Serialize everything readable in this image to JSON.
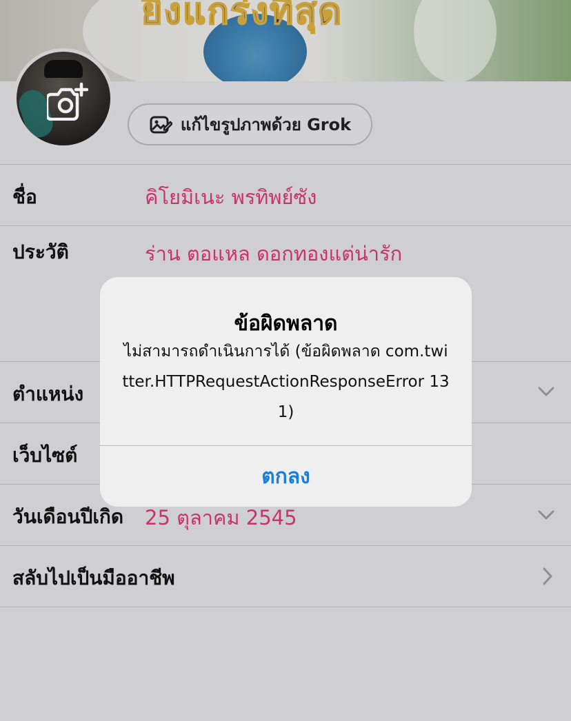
{
  "banner": {
    "text": "ยิ่งแกร่งที่สุด"
  },
  "grok_button": {
    "label": "แก้ไขรูปภาพด้วย Grok"
  },
  "rows": {
    "name": {
      "label": "ชื่อ",
      "value": "คิโยมิเนะ พรทิพย์ซัง"
    },
    "bio": {
      "label": "ประวัติ",
      "value": "ร่าน ตอแหล ดอกทองแต่น่ารัก"
    },
    "location": {
      "label": "ตำแหน่ง"
    },
    "website": {
      "label": "เว็บไซต์"
    },
    "birthday": {
      "label": "วันเดือนปีเกิด",
      "value": "25 ตุลาคม 2545"
    },
    "professional": {
      "label": "สลับไปเป็นมืออาชีพ"
    }
  },
  "alert": {
    "title": "ข้อผิดพลาด",
    "message": "ไม่สามารถดำเนินการได้ (ข้อผิดพลาด com.twitter.HTTPRequestActionResponseError 131)",
    "ok_label": "ตกลง"
  },
  "colors": {
    "accent_value": "#c8326d",
    "alert_button": "#1b7fd9",
    "background": "#cfcfd1"
  },
  "icons": {
    "camera": "camera-plus-icon",
    "grok": "image-edit-icon",
    "chevron_down": "chevron-down-icon",
    "chevron_right": "chevron-right-icon"
  }
}
